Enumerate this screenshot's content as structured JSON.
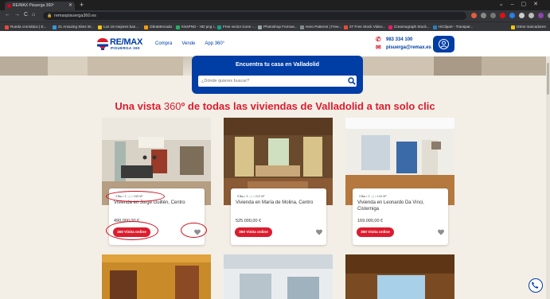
{
  "browser": {
    "tab_title": "RE/MAX Pisuerga 360º",
    "url": "remaxpisuerga360.es",
    "bookmarks": [
      "Rueda cromática | E...",
      "21 Amazing Sites W...",
      "Los 16 mejores ban...",
      "ObraMercado",
      "KissPNG - HD png i...",
      "Free vector icons -...",
      "Photoshop Formas...",
      "Hero Patterns | Free...",
      "27 Free Stock Video...",
      "Creamograph Stock...",
      "HiClipart - Transpar...",
      "Otros marcadores"
    ]
  },
  "header": {
    "logo_main": "RE/MAX",
    "logo_sub": "PISUERGA 360",
    "nav": [
      "Compra",
      "Vende",
      "App 360°"
    ],
    "phone": "983 334 100",
    "email": "pisuerga@remax.es"
  },
  "search": {
    "title": "Encuentra tu casa en Valladolid",
    "placeholder": "¿Dónde quieres buscar?"
  },
  "headline": {
    "before": "Una vista ",
    "number": "360",
    "after": "º de todas las viviendas de Valladolid a tan solo clic"
  },
  "listings": [
    {
      "meta": "3 🛏 • 3 🛁 • 155 M²",
      "title": "Vivienda en Jorge Guillén, Centro",
      "price": "490.000,00 €",
      "button": "Visita online"
    },
    {
      "meta": "5 🛏 • 3 🛁 • 212 M²",
      "title": "Vivienda en María de Molina, Centro",
      "price": "525.000,00 €",
      "button": "Visita online"
    },
    {
      "meta": "3 🛏 • 2 🛁 • 144 M²",
      "title": "Vivienda en Leonardo Da Vinci, Cisterniga",
      "price": "169.000,00 €",
      "button": "Visita online"
    }
  ],
  "colors": {
    "brand_blue": "#003da5",
    "brand_red": "#dc1c2e",
    "page_bg": "#f3efe6"
  }
}
